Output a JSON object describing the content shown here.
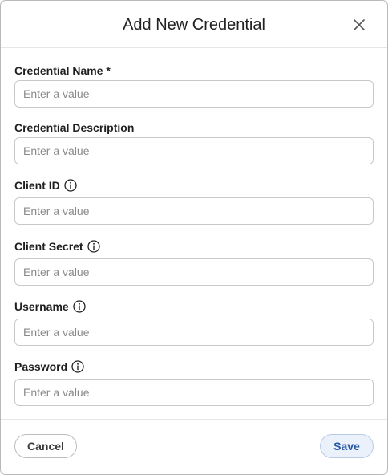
{
  "dialog": {
    "title": "Add New Credential",
    "close_icon": "close-icon"
  },
  "fields": [
    {
      "label": "Credential Name *",
      "placeholder": "Enter a value",
      "value": "",
      "has_info": false
    },
    {
      "label": "Credential Description",
      "placeholder": "Enter a value",
      "value": "",
      "has_info": false
    },
    {
      "label": "Client ID",
      "placeholder": "Enter a value",
      "value": "",
      "has_info": true
    },
    {
      "label": "Client Secret",
      "placeholder": "Enter a value",
      "value": "",
      "has_info": true
    },
    {
      "label": "Username",
      "placeholder": "Enter a value",
      "value": "",
      "has_info": true
    },
    {
      "label": "Password",
      "placeholder": "Enter a value",
      "value": "",
      "has_info": true
    }
  ],
  "footer": {
    "cancel_label": "Cancel",
    "save_label": "Save"
  },
  "colors": {
    "save_accent": "#2456a3",
    "save_background": "#eaf1fb",
    "border": "#c9c9c9"
  }
}
